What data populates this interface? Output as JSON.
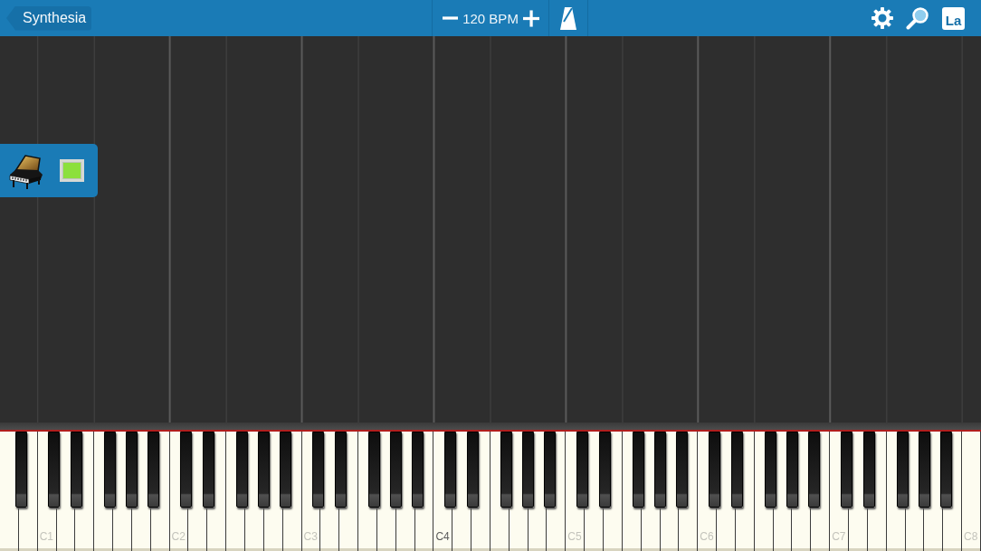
{
  "header": {
    "back_button": "Synthesia",
    "tempo": "120 BPM",
    "note_names_button": "La"
  },
  "tracks": [
    {
      "color": "#8ce03c"
    }
  ],
  "keyboard": {
    "octave_labels": [
      {
        "text": "C1",
        "emphasized": false
      },
      {
        "text": "C2",
        "emphasized": false
      },
      {
        "text": "C3",
        "emphasized": false
      },
      {
        "text": "C4",
        "emphasized": true
      },
      {
        "text": "C5",
        "emphasized": false
      },
      {
        "text": "C6",
        "emphasized": false
      },
      {
        "text": "C7",
        "emphasized": false
      },
      {
        "text": "C8",
        "emphasized": false
      }
    ]
  }
}
